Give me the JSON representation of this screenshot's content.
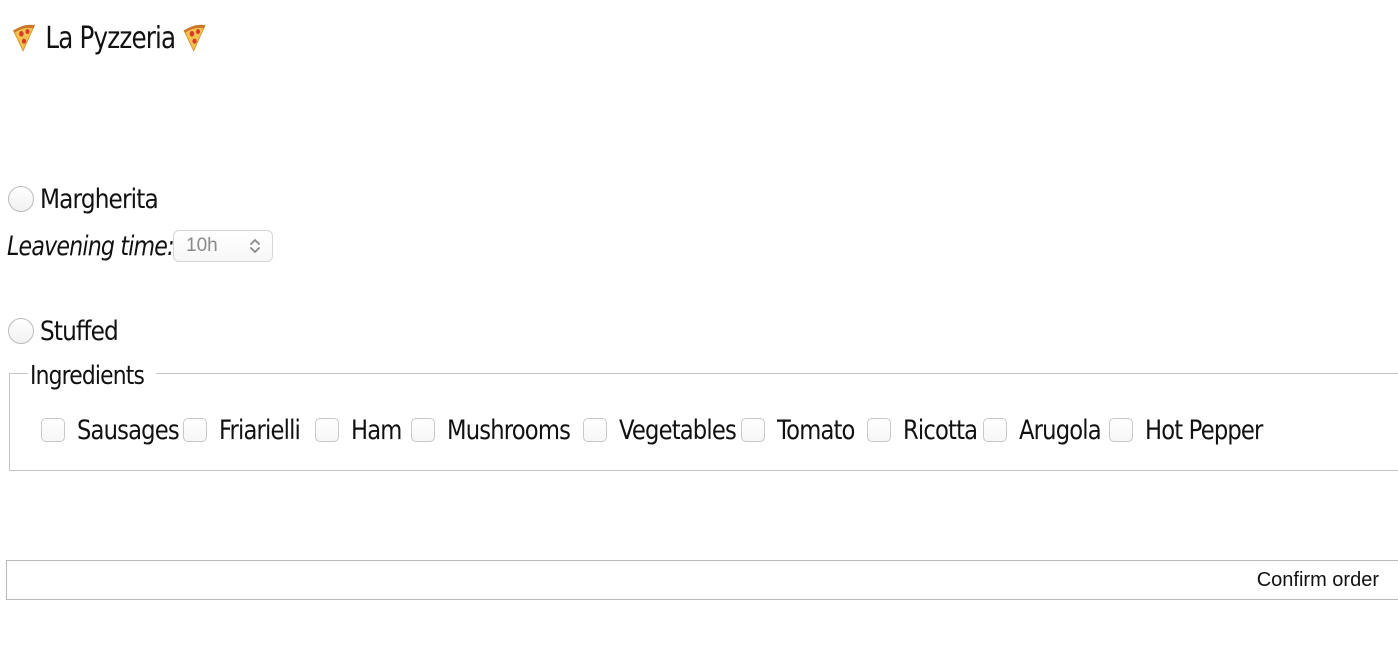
{
  "header": {
    "title": "La Pyzzeria",
    "icon_left": "pizza-slice-icon",
    "icon_right": "pizza-slice-icon"
  },
  "pizzas": {
    "margherita": {
      "label": "Margherita",
      "leavening_label": "Leavening time:",
      "leavening_value": "10h"
    },
    "stuffed": {
      "label": "Stuffed",
      "ingredients_legend": "Ingredients",
      "ingredients": [
        {
          "label": "Sausages",
          "checked": false
        },
        {
          "label": "Friarielli",
          "checked": false
        },
        {
          "label": "Ham",
          "checked": false
        },
        {
          "label": "Mushrooms",
          "checked": false
        },
        {
          "label": "Vegetables",
          "checked": false
        },
        {
          "label": "Tomato",
          "checked": false
        },
        {
          "label": "Ricotta",
          "checked": false
        },
        {
          "label": "Arugola",
          "checked": false
        },
        {
          "label": "Hot Pepper",
          "checked": false
        }
      ]
    }
  },
  "actions": {
    "confirm_label": "Confirm order"
  }
}
